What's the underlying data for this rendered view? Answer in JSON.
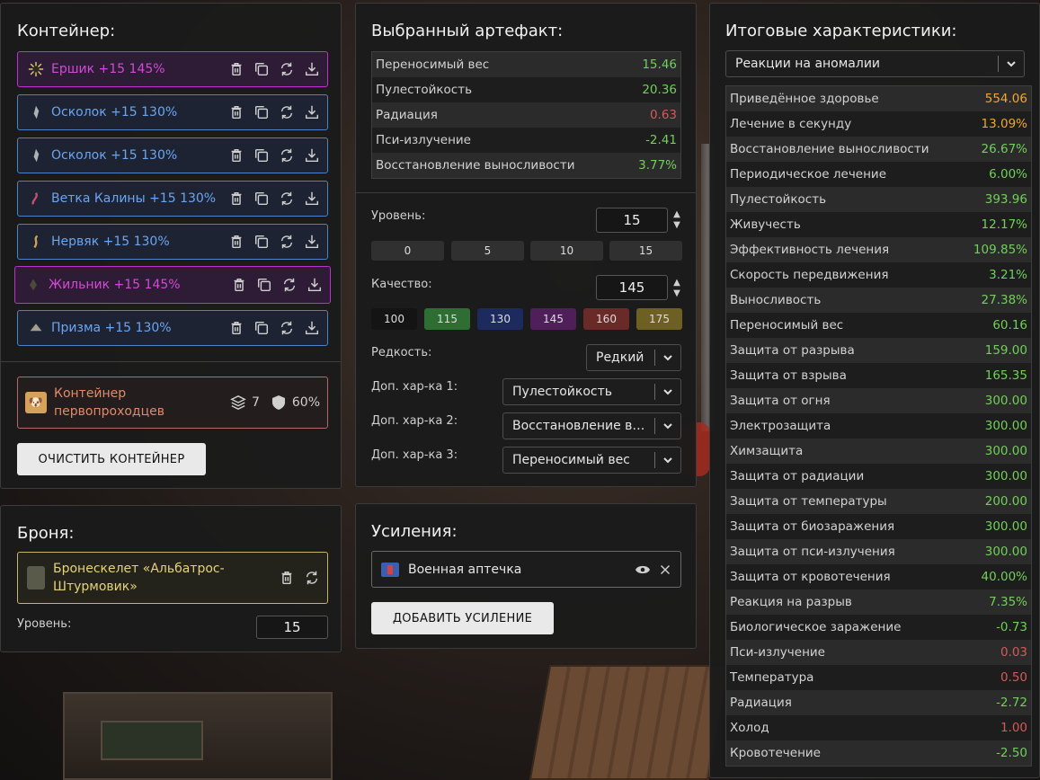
{
  "container": {
    "title": "Контейнер:",
    "items": [
      {
        "name": "Ершик +15 145%",
        "rarity": "legend",
        "icon": "spiky-artifact-icon"
      },
      {
        "name": "Осколок +15 130%",
        "rarity": "rare",
        "icon": "shard-artifact-icon"
      },
      {
        "name": "Осколок +15 130%",
        "rarity": "rare",
        "icon": "shard-artifact-icon"
      },
      {
        "name": "Ветка Калины +15 130%",
        "rarity": "rare",
        "icon": "branch-artifact-icon"
      },
      {
        "name": "Нервяк +15 130%",
        "rarity": "rare",
        "icon": "nerve-artifact-icon"
      },
      {
        "name": "Жильник +15 145%",
        "rarity": "legend",
        "icon": "vein-artifact-icon"
      },
      {
        "name": "Призма +15 130%",
        "rarity": "rare",
        "icon": "prism-artifact-icon"
      }
    ],
    "box": {
      "name_line1": "Контейнер",
      "name_line2": "первопроходцев",
      "slots": "7",
      "protection": "60%"
    },
    "clear_label": "ОЧИСТИТЬ КОНТЕЙНЕР"
  },
  "armor": {
    "title": "Броня:",
    "name_line1": "Бронескелет «Альбатрос-",
    "name_line2": "Штурмовик»",
    "level_label": "Уровень:",
    "level_value": "15"
  },
  "artifact": {
    "title": "Выбранный артефакт:",
    "stats": [
      {
        "name": "Переносимый вес",
        "value": "15.46",
        "color": "green"
      },
      {
        "name": "Пулестойкость",
        "value": "20.36",
        "color": "green"
      },
      {
        "name": "Радиация",
        "value": "0.63",
        "color": "red"
      },
      {
        "name": "Пси-излучение",
        "value": "-2.41",
        "color": "green"
      },
      {
        "name": "Восстановление выносливости",
        "value": "3.77%",
        "color": "green"
      }
    ],
    "level_label": "Уровень:",
    "level_value": "15",
    "level_presets": [
      "0",
      "5",
      "10",
      "15"
    ],
    "quality_label": "Качество:",
    "quality_value": "145",
    "quality_presets": [
      {
        "label": "100",
        "color": "#141414"
      },
      {
        "label": "115",
        "color": "#2f6e32"
      },
      {
        "label": "130",
        "color": "#1d2a5e"
      },
      {
        "label": "145",
        "color": "#4f1f5a"
      },
      {
        "label": "160",
        "color": "#6a2a28"
      },
      {
        "label": "175",
        "color": "#6e6022"
      }
    ],
    "rarity_label": "Редкость:",
    "rarity_value": "Редкий",
    "extra1_label": "Доп. хар-ка 1:",
    "extra1_value": "Пулестойкость",
    "extra2_label": "Доп. хар-ка 2:",
    "extra2_value": "Восстановление выносливости",
    "extra3_label": "Доп. хар-ка 3:",
    "extra3_value": "Переносимый вес"
  },
  "buffs": {
    "title": "Усиления:",
    "items": [
      {
        "name": "Военная аптечка"
      }
    ],
    "add_label": "ДОБАВИТЬ УСИЛЕНИЕ"
  },
  "totals": {
    "title": "Итоговые характеристики:",
    "filter_value": "Реакции на аномалии",
    "stats": [
      {
        "name": "Приведённое здоровье",
        "value": "554.06",
        "color": "orange"
      },
      {
        "name": "Лечение в секунду",
        "value": "13.09%",
        "color": "orange"
      },
      {
        "name": "Восстановление выносливости",
        "value": "26.67%",
        "color": "green"
      },
      {
        "name": "Периодическое лечение",
        "value": "6.00%",
        "color": "green"
      },
      {
        "name": "Пулестойкость",
        "value": "393.96",
        "color": "green"
      },
      {
        "name": "Живучесть",
        "value": "12.17%",
        "color": "green"
      },
      {
        "name": "Эффективность лечения",
        "value": "109.85%",
        "color": "green"
      },
      {
        "name": "Скорость передвижения",
        "value": "3.21%",
        "color": "green"
      },
      {
        "name": "Выносливость",
        "value": "27.38%",
        "color": "green"
      },
      {
        "name": "Переносимый вес",
        "value": "60.16",
        "color": "green"
      },
      {
        "name": "Защита от разрыва",
        "value": "159.00",
        "color": "green"
      },
      {
        "name": "Защита от взрыва",
        "value": "165.35",
        "color": "green"
      },
      {
        "name": "Защита от огня",
        "value": "300.00",
        "color": "green"
      },
      {
        "name": "Электрозащита",
        "value": "300.00",
        "color": "green"
      },
      {
        "name": "Химзащита",
        "value": "300.00",
        "color": "green"
      },
      {
        "name": "Защита от радиации",
        "value": "300.00",
        "color": "green"
      },
      {
        "name": "Защита от температуры",
        "value": "200.00",
        "color": "green"
      },
      {
        "name": "Защита от биозаражения",
        "value": "300.00",
        "color": "green"
      },
      {
        "name": "Защита от пси-излучения",
        "value": "300.00",
        "color": "green"
      },
      {
        "name": "Защита от кровотечения",
        "value": "40.00%",
        "color": "green"
      },
      {
        "name": "Реакция на разрыв",
        "value": "7.35%",
        "color": "green"
      },
      {
        "name": "Биологическое заражение",
        "value": "-0.73",
        "color": "green"
      },
      {
        "name": "Пси-излучение",
        "value": "0.03",
        "color": "red"
      },
      {
        "name": "Температура",
        "value": "0.50",
        "color": "red"
      },
      {
        "name": "Радиация",
        "value": "-2.72",
        "color": "green"
      },
      {
        "name": "Холод",
        "value": "1.00",
        "color": "red"
      },
      {
        "name": "Кровотечение",
        "value": "-2.50",
        "color": "green"
      }
    ]
  },
  "colors": {
    "green": "#72cf5a",
    "red": "#d35a5a",
    "orange": "#f0a832",
    "rare_border": "#4e82c7",
    "legend_border": "#c02fd1"
  }
}
